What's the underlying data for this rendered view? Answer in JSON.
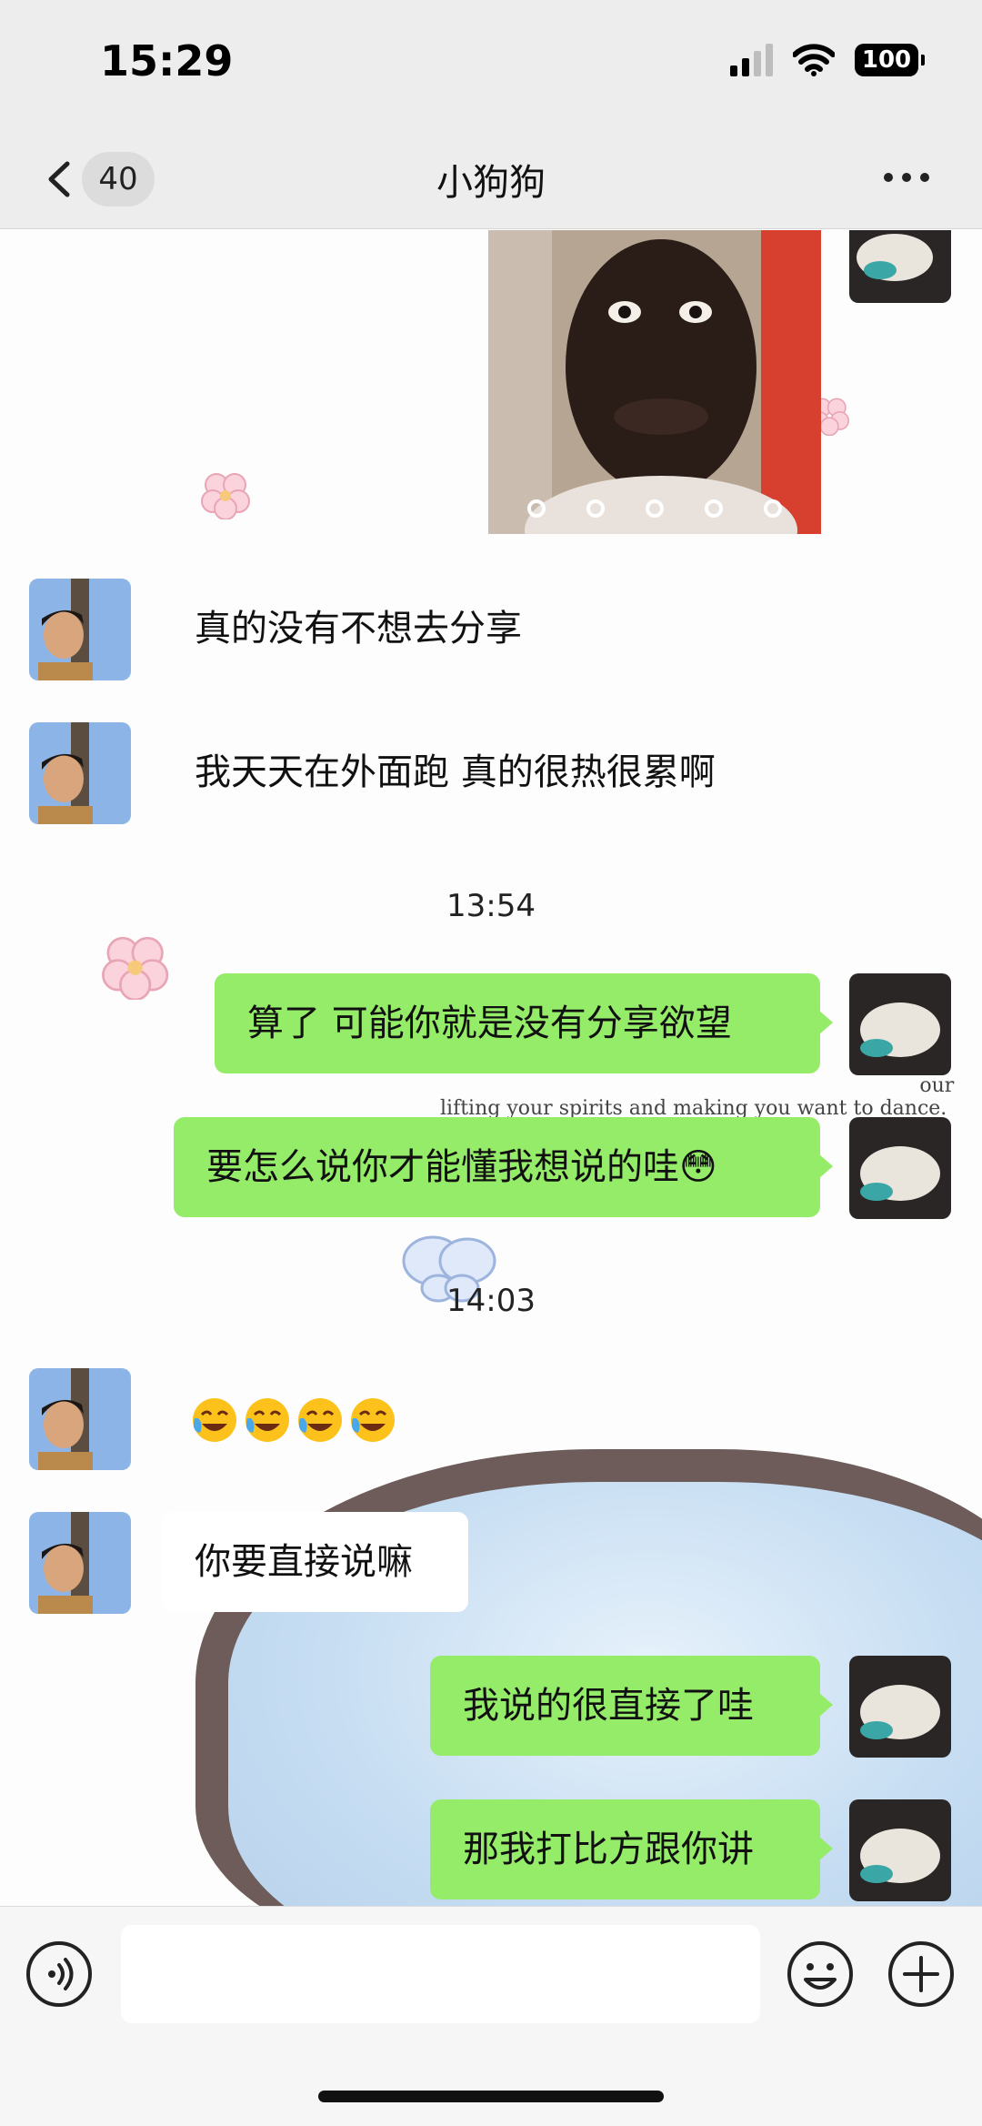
{
  "status_bar": {
    "time": "15:29",
    "battery": "100"
  },
  "nav": {
    "unread_count": "40",
    "title": "小狗狗"
  },
  "background": {
    "caption_line1": "our",
    "caption_line2": "lifting your spirits and making you want to dance."
  },
  "messages": {
    "m1": "真的没有不想去分享",
    "m2": "我天天在外面跑 真的很热很累啊",
    "time1": "13:54",
    "m3": "算了 可能你就是没有分享欲望",
    "m4": "要怎么说你才能懂我想说的哇😳",
    "time2": "14:03",
    "m5_emoji_count": 4,
    "m6": "你要直接说嘛",
    "m7": "我说的很直接了哇",
    "m8": "那我打比方跟你讲"
  },
  "input": {
    "placeholder": ""
  },
  "colors": {
    "outgoing_bubble": "#95ec69",
    "header_bg": "#ededed",
    "input_bar_bg": "#f6f6f6"
  },
  "icons": {
    "back": "chevron-left-icon",
    "more": "more-dots-icon",
    "voice": "voice-icon",
    "emoji": "smiley-icon",
    "plus": "plus-icon",
    "laugh": "tears-of-joy-icon"
  }
}
